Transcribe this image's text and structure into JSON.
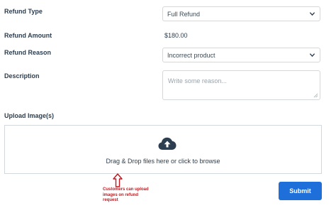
{
  "form": {
    "refund_type": {
      "label": "Refund Type",
      "selected": "Full Refund"
    },
    "refund_amount": {
      "label": "Refund Amount",
      "value": "$180.00"
    },
    "refund_reason": {
      "label": "Refund Reason",
      "selected": "Incorrect product"
    },
    "description": {
      "label": "Description",
      "placeholder": "Write some reason..."
    },
    "upload": {
      "label": "Upload Image(s)",
      "dropzone_text": "Drag & Drop files here or click to browse"
    },
    "submit_label": "Submit"
  },
  "annotation": {
    "note": "Customers can upload images on refund request",
    "color": "#c0191f"
  },
  "colors": {
    "primary": "#1e6fd9",
    "text": "#2c3e50",
    "border": "#d3d8dd"
  },
  "icons": [
    "chevron-down-icon",
    "cloud-upload-icon",
    "resize-grip-icon",
    "arrow-up-icon"
  ]
}
